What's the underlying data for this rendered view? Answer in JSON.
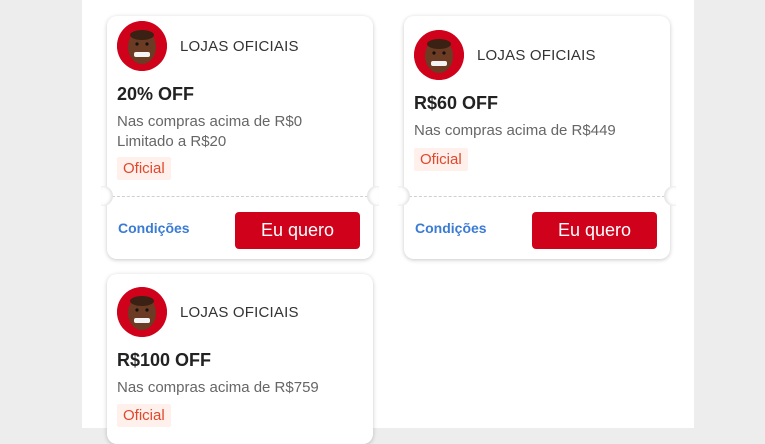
{
  "coupons": [
    {
      "store": "LOJAS OFICIAIS",
      "title": "20% OFF",
      "min_purchase": "Nas compras acima de R$0",
      "limit": "Limitado a R$20",
      "badge": "Oficial",
      "conditions_label": "Condições",
      "cta_label": "Eu quero"
    },
    {
      "store": "LOJAS OFICIAIS",
      "title": "R$60 OFF",
      "min_purchase": "Nas compras acima de R$449",
      "badge": "Oficial",
      "conditions_label": "Condições",
      "cta_label": "Eu quero"
    },
    {
      "store": "LOJAS OFICIAIS",
      "title": "R$100 OFF",
      "min_purchase": "Nas compras acima de R$759",
      "badge": "Oficial"
    }
  ],
  "colors": {
    "brand_red": "#d0021b",
    "link_blue": "#3a7bd5",
    "badge_text": "#e0482c",
    "badge_bg": "#fff0ec"
  },
  "icons": {
    "store_avatar": "store-avatar-icon"
  }
}
